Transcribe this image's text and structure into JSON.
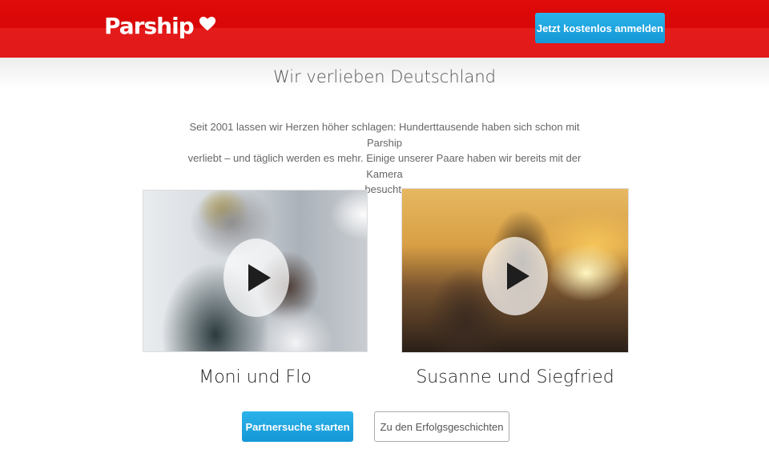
{
  "header": {
    "logo_text": "Parship",
    "logo_icon": "heart-icon",
    "cta_label": "Jetzt kostenlos anmelden"
  },
  "main": {
    "headline": "Wir verlieben Deutschland",
    "intro_line1": "Seit 2001 lassen wir Herzen höher schlagen: Hunderttausende haben sich schon mit Parship",
    "intro_line2": "verliebt – und täglich werden es mehr. Einige unserer Paare haben wir bereits mit der Kamera",
    "intro_line3": "besucht.",
    "videos": [
      {
        "caption": "Moni und Flo",
        "icon": "play-icon"
      },
      {
        "caption": "Susanne und Siegfried",
        "icon": "play-icon"
      }
    ],
    "primary_button": "Partnersuche starten",
    "secondary_button": "Zu den Erfolgsgeschichten"
  },
  "colors": {
    "header_red": "#e00a0a",
    "button_blue": "#1ea5e0"
  }
}
